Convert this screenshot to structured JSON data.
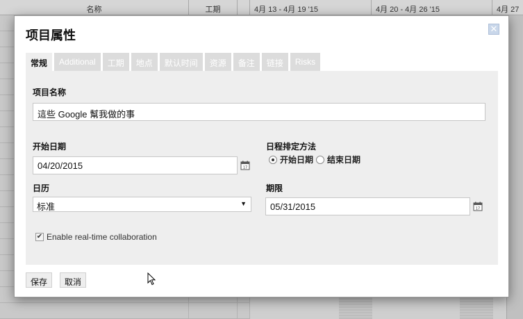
{
  "background": {
    "columns": {
      "name": "名称",
      "duration": "工期"
    },
    "weeks": [
      "4月 13 - 4月 19 '15",
      "4月 20 - 4月 26 '15",
      "4月 27"
    ]
  },
  "dialog": {
    "title": "项目属性",
    "close_icon": "close-icon",
    "tabs": [
      {
        "label": "常规",
        "active": true
      },
      {
        "label": "Additional",
        "active": false
      },
      {
        "label": "工期",
        "active": false
      },
      {
        "label": "地点",
        "active": false
      },
      {
        "label": "默认时间",
        "active": false
      },
      {
        "label": "资源",
        "active": false
      },
      {
        "label": "备注",
        "active": false
      },
      {
        "label": "链接",
        "active": false
      },
      {
        "label": "Risks",
        "active": false
      }
    ],
    "general": {
      "project_name_label": "项目名称",
      "project_name_value": "這些 Google 幫我做的事",
      "start_date_label": "开始日期",
      "start_date_value": "04/20/2015",
      "scheduling_label": "日程排定方法",
      "scheduling_options": [
        {
          "label": "开始日期",
          "selected": true
        },
        {
          "label": "结束日期",
          "selected": false
        }
      ],
      "calendar_label": "日历",
      "calendar_value": "标准",
      "deadline_label": "期限",
      "deadline_value": "05/31/2015",
      "realtime_label": "Enable real-time collaboration",
      "realtime_checked": true
    },
    "buttons": {
      "save": "保存",
      "cancel": "取消"
    }
  },
  "colors": {
    "tab_inactive": "#dcdcdc",
    "panel_bg": "#eeeeee",
    "close_btn": "#c9d7ea"
  }
}
